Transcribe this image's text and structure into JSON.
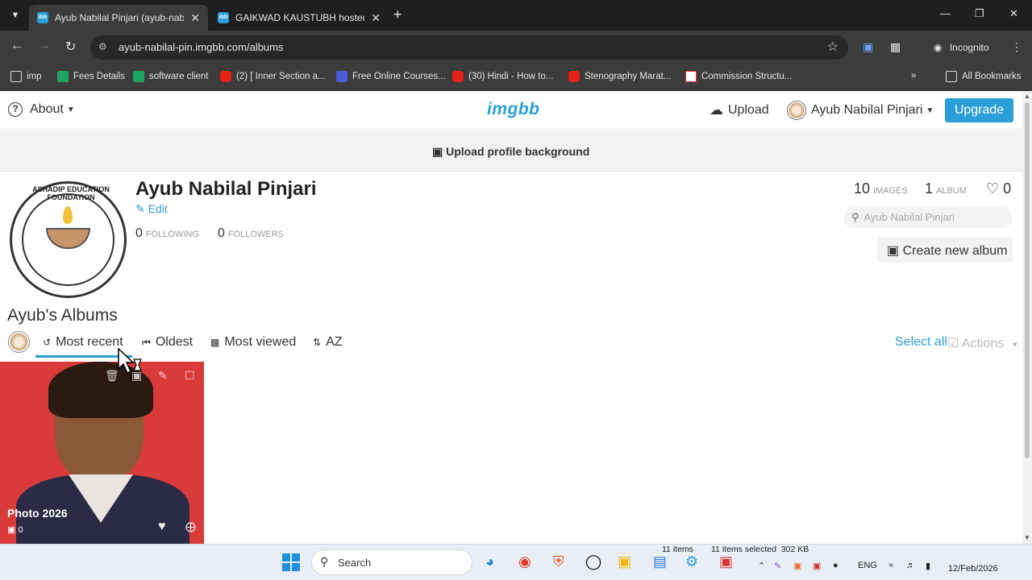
{
  "browser": {
    "tabs": [
      {
        "title": "Ayub Nabilal Pinjari (ayub-nabil",
        "favicon": "ibb",
        "active": true
      },
      {
        "title": "GAIKWAD KAUSTUBH hosted at",
        "favicon": "ibb",
        "active": false
      }
    ],
    "url": "ayub-nabilal-pin.imgbb.com/albums",
    "profile_label": "Incognito",
    "bookmarks": [
      {
        "label": "imp",
        "icon": "folder-icon"
      },
      {
        "label": "Fees Details",
        "icon": "sheets-icon"
      },
      {
        "label": "software client",
        "icon": "sheets-icon"
      },
      {
        "label": "(2) [ Inner Section a...",
        "icon": "youtube-icon"
      },
      {
        "label": "Free Online Courses...",
        "icon": "course-icon"
      },
      {
        "label": "(30) Hindi - How to...",
        "icon": "youtube-icon"
      },
      {
        "label": "Stenography Marat...",
        "icon": "youtube-icon"
      },
      {
        "label": "Commission Structu...",
        "icon": "doc-icon"
      }
    ],
    "all_bookmarks": "All Bookmarks"
  },
  "header": {
    "about_label": "About",
    "logo": "imgbb",
    "upload_label": "Upload",
    "user_name": "Ayub Nabilal Pinjari",
    "upgrade_label": "Upgrade"
  },
  "profile": {
    "background_label": "Upload profile background",
    "name": "Ayub Nabilal Pinjari",
    "edit_label": "Edit",
    "following_count": "0",
    "following_label": "FOLLOWING",
    "followers_count": "0",
    "followers_label": "FOLLOWERS",
    "images_count": "10",
    "images_label": "IMAGES",
    "albums_count": "1",
    "albums_label": "ALBUM",
    "likes_count": "0",
    "search_placeholder": "Ayub Nabilal Pinjari",
    "create_album_label": "Create new album",
    "avatar_text": "ASHADIP EDUCATION FOUNDATION"
  },
  "albums": {
    "title": "Ayub's Albums",
    "sort_options": [
      {
        "label": "Most recent",
        "icon": "history-icon",
        "active": true
      },
      {
        "label": "Oldest",
        "icon": "backward-icon",
        "active": false
      },
      {
        "label": "Most viewed",
        "icon": "chart-icon",
        "active": false
      },
      {
        "label": "AZ",
        "icon": "sort-alpha-icon",
        "active": false
      }
    ],
    "select_all_label": "Select all",
    "actions_label": "Actions",
    "items": [
      {
        "title": "Photo 2026",
        "image_count": "0"
      }
    ]
  },
  "taskbar": {
    "search_label": "Search",
    "explorer_status": {
      "items": "11 items",
      "selected": "11 items selected  302 KB"
    },
    "language": "ENG",
    "date": "12/Feb/2026"
  },
  "colors": {
    "accent": "#2a9ed8",
    "chrome_dark": "#3c3c3c",
    "album_cover_bg": "#d93a3a"
  }
}
